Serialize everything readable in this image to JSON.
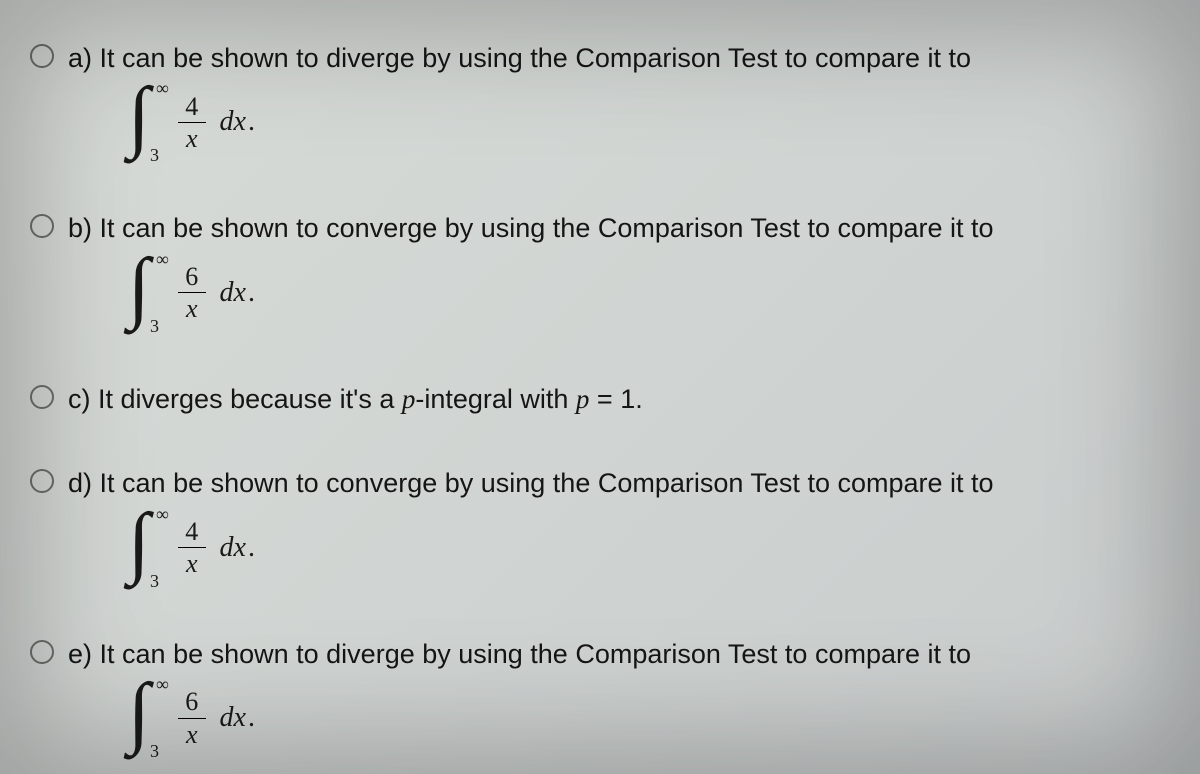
{
  "options": [
    {
      "label": "a)",
      "text": "It can be shown to diverge by using the Comparison Test to compare it to",
      "has_integral": true,
      "integral": {
        "lower": "3",
        "upper": "∞",
        "num": "4",
        "den": "x",
        "dx": "dx",
        "dot": "."
      }
    },
    {
      "label": "b)",
      "text": "It can be shown to converge by using the Comparison Test to compare it to",
      "has_integral": true,
      "integral": {
        "lower": "3",
        "upper": "∞",
        "num": "6",
        "den": "x",
        "dx": "dx",
        "dot": "."
      }
    },
    {
      "label": "c)",
      "text_pre": "It diverges because it's a ",
      "p_word": "p",
      "text_mid": "-integral with ",
      "p_var": "p",
      "text_post": " = 1.",
      "has_integral": false
    },
    {
      "label": "d)",
      "text": "It can be shown to converge by using the Comparison Test to compare it to",
      "has_integral": true,
      "integral": {
        "lower": "3",
        "upper": "∞",
        "num": "4",
        "den": "x",
        "dx": "dx",
        "dot": "."
      }
    },
    {
      "label": "e)",
      "text": "It can be shown to diverge by using the Comparison Test to compare it to",
      "has_integral": true,
      "integral": {
        "lower": "3",
        "upper": "∞",
        "num": "6",
        "den": "x",
        "dx": "dx",
        "dot": "."
      }
    }
  ]
}
